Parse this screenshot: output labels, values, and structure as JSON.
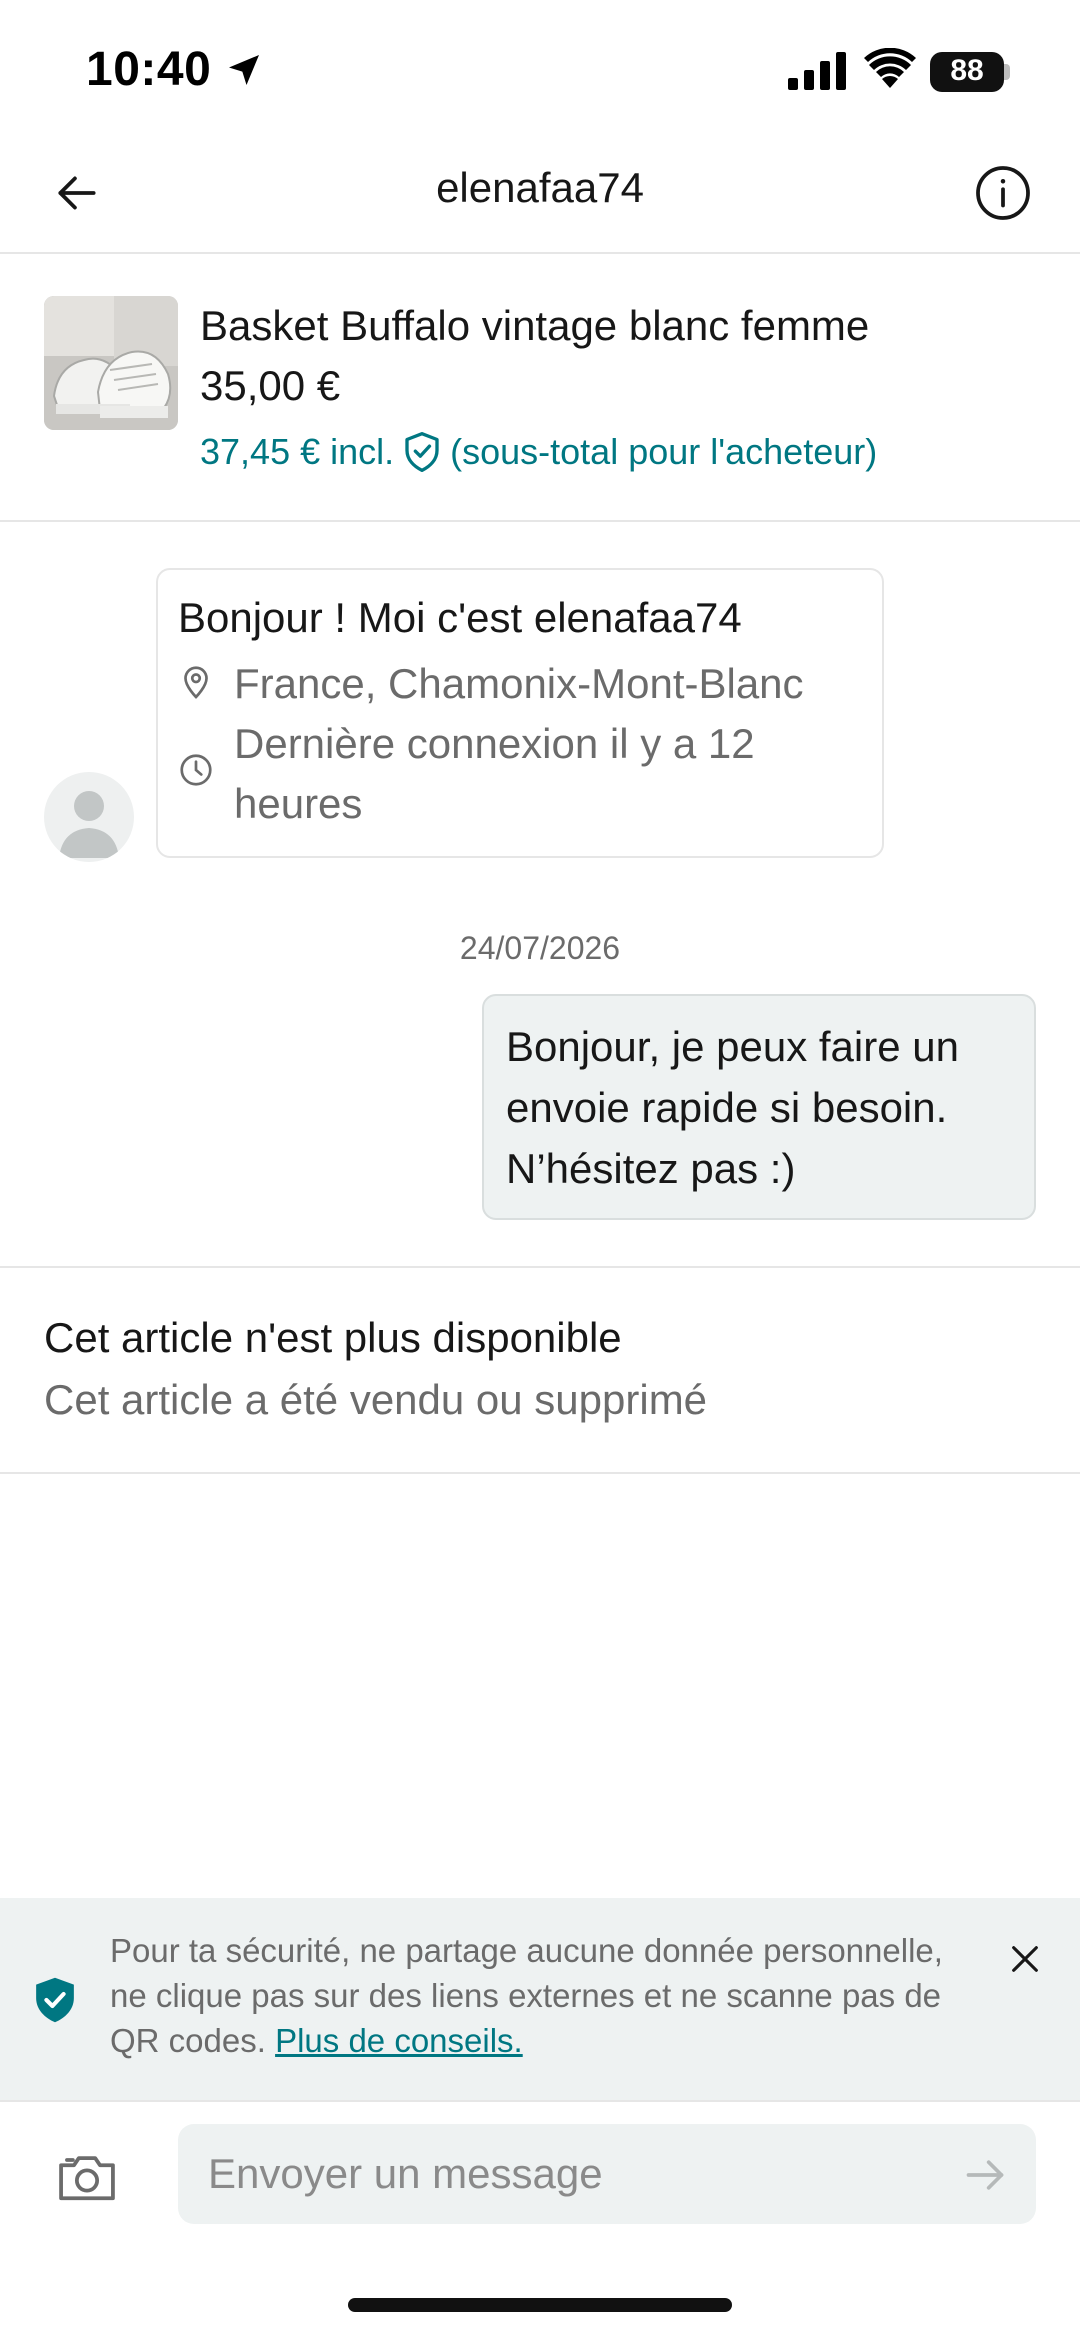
{
  "status_bar": {
    "time": "10:40",
    "battery": "88"
  },
  "header": {
    "title": "elenafaa74",
    "back_icon": "arrow-left-icon",
    "info_icon": "info-circle-icon"
  },
  "item": {
    "title": "Basket Buffalo vintage blanc femme",
    "price": "35,00 €",
    "buyer_price": "37,45 € incl.",
    "buyer_note": "(sous-total pour l'acheteur)",
    "accent_color": "#007782"
  },
  "profile": {
    "greeting": "Bonjour ! Moi c'est elenafaa74",
    "location": "France, Chamonix-Mont-Blanc",
    "last_seen": "Dernière connexion il y a 12 heures"
  },
  "conversation": {
    "date": "24/07/2026",
    "messages": [
      {
        "direction": "outgoing",
        "text": "Bonjour, je peux faire un envoie rapide si besoin. N’hésitez pas :)"
      }
    ]
  },
  "unavailable": {
    "title": "Cet article n'est plus disponible",
    "subtitle": "Cet article a été vendu ou supprimé"
  },
  "safety": {
    "text": "Pour ta sécurité, ne partage aucune donnée personnelle, ne clique pas sur des liens externes et ne scanne pas de QR codes.",
    "link": "Plus de conseils."
  },
  "composer": {
    "placeholder": "Envoyer un message"
  }
}
